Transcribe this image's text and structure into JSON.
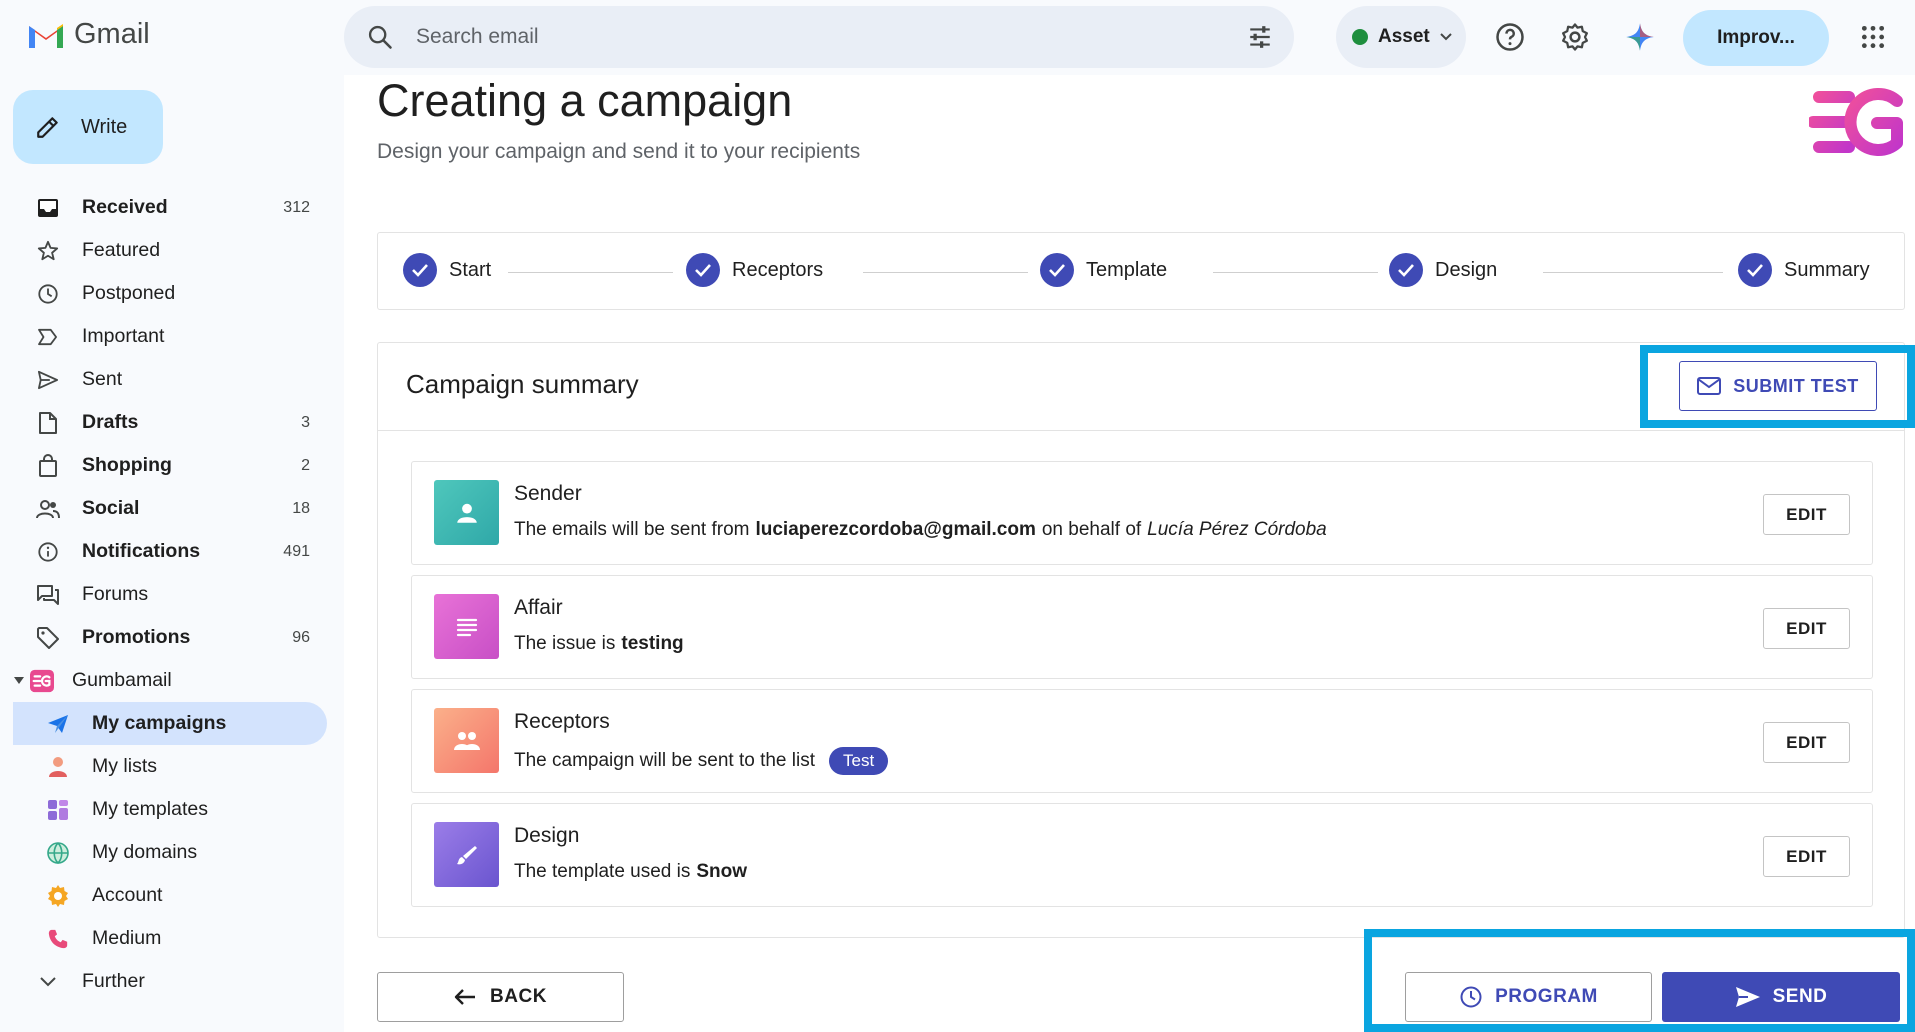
{
  "app": {
    "name": "Gmail"
  },
  "search": {
    "placeholder": "Search email"
  },
  "status": {
    "label": "Asset",
    "color": "#1e8e3e"
  },
  "header": {
    "improve_label": "Improv..."
  },
  "compose": {
    "label": "Write"
  },
  "sidebar": {
    "items": [
      {
        "label": "Received",
        "count": "312",
        "bold": true,
        "icon": "inbox-icon"
      },
      {
        "label": "Featured",
        "count": "",
        "bold": false,
        "icon": "star-icon"
      },
      {
        "label": "Postponed",
        "count": "",
        "bold": false,
        "icon": "clock-icon"
      },
      {
        "label": "Important",
        "count": "",
        "bold": false,
        "icon": "label-important-icon"
      },
      {
        "label": "Sent",
        "count": "",
        "bold": false,
        "icon": "send-icon"
      },
      {
        "label": "Drafts",
        "count": "3",
        "bold": true,
        "icon": "draft-icon"
      },
      {
        "label": "Shopping",
        "count": "2",
        "bold": true,
        "icon": "shopping-bag-icon"
      },
      {
        "label": "Social",
        "count": "18",
        "bold": true,
        "icon": "people-icon"
      },
      {
        "label": "Notifications",
        "count": "491",
        "bold": true,
        "icon": "info-icon"
      },
      {
        "label": "Forums",
        "count": "",
        "bold": false,
        "icon": "forum-icon"
      },
      {
        "label": "Promotions",
        "count": "96",
        "bold": true,
        "icon": "tag-icon"
      }
    ],
    "group": {
      "label": "Gumbamail"
    },
    "sub_items": [
      {
        "label": "My campaigns",
        "icon": "paper-plane-icon",
        "active": true
      },
      {
        "label": "My lists",
        "icon": "person-icon"
      },
      {
        "label": "My templates",
        "icon": "template-grid-icon"
      },
      {
        "label": "My domains",
        "icon": "globe-icon"
      },
      {
        "label": "Account",
        "icon": "gear-orange-icon"
      },
      {
        "label": "Medium",
        "icon": "phone-icon"
      }
    ],
    "more": {
      "label": "Further"
    }
  },
  "page": {
    "title": "Creating a campaign",
    "subtitle": "Design your campaign and send it to your recipients"
  },
  "stepper": {
    "steps": [
      "Start",
      "Receptors",
      "Template",
      "Design",
      "Summary"
    ]
  },
  "summary": {
    "title": "Campaign summary",
    "submit_test_label": "SUBMIT TEST",
    "edit_label": "EDIT",
    "sender": {
      "title": "Sender",
      "prefix": "The emails will be sent from",
      "email": "luciaperezcordoba@gmail.com",
      "middle": "on behalf of",
      "name": "Lucía Pérez Córdoba",
      "color": "#3fb7b0"
    },
    "affair": {
      "title": "Affair",
      "prefix": "The issue is",
      "value": "testing",
      "color": "#d65bd0"
    },
    "receptors": {
      "title": "Receptors",
      "prefix": "The campaign will be sent to the list",
      "badge": "Test",
      "color": "#f58f6d"
    },
    "design": {
      "title": "Design",
      "prefix": "The template used is",
      "value": "Snow",
      "color": "#8468d9"
    }
  },
  "footer": {
    "back_label": "BACK",
    "program_label": "PROGRAM",
    "send_label": "SEND"
  },
  "colors": {
    "accent": "#3f4ab5",
    "highlight": "#0aa5e0",
    "compose_bg": "#c2e7ff"
  }
}
